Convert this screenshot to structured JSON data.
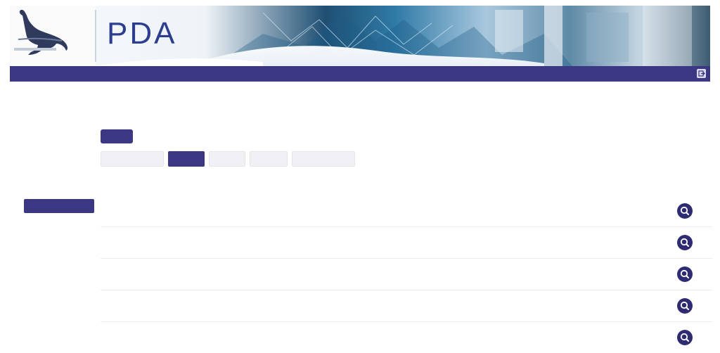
{
  "header": {
    "logo_wordmark": "",
    "logo_kicker": "",
    "title": "PDA",
    "tagline": ""
  },
  "topbar": {
    "session_text": "",
    "logout_icon": "logout-icon"
  },
  "sidebar": {
    "items": [
      {
        "label": "",
        "active": false
      },
      {
        "label": "",
        "active": false
      },
      {
        "label": "",
        "active": false
      },
      {
        "label": "",
        "active": false
      },
      {
        "label": "",
        "active": false
      },
      {
        "label": "",
        "active": true
      }
    ]
  },
  "main": {
    "primary_button_label": "",
    "tabs": [
      {
        "label": "",
        "active": false
      },
      {
        "label": "",
        "active": true
      },
      {
        "label": "",
        "active": false
      },
      {
        "label": "",
        "active": false
      },
      {
        "label": "",
        "active": false
      }
    ],
    "table": {
      "columns": [
        "",
        "",
        "",
        ""
      ],
      "rows": [
        {
          "id": "",
          "reference": "",
          "location": ""
        },
        {
          "id": "",
          "reference": "",
          "location": ""
        },
        {
          "id": "",
          "reference": "",
          "location": ""
        },
        {
          "id": "",
          "reference": "",
          "location": ""
        },
        {
          "id": "",
          "reference": "",
          "location": ""
        }
      ],
      "row_action_icon": "search-icon"
    }
  },
  "colors": {
    "primary": "#3b3782",
    "action_button": "#2f2b73",
    "brand_text": "#2d3e8f"
  }
}
